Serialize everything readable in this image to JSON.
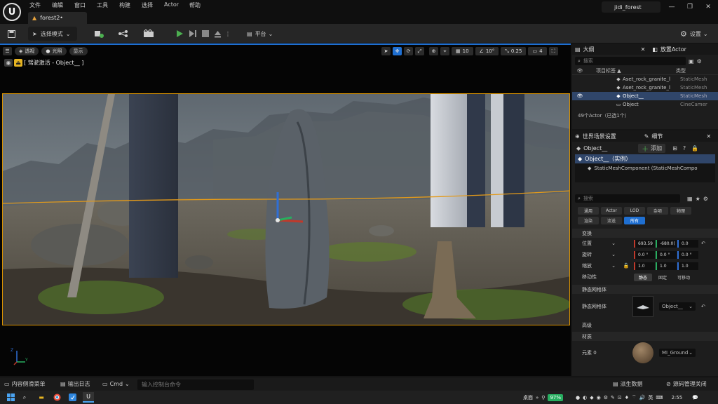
{
  "titlebar": {
    "logo": "U",
    "menu": [
      "文件",
      "编辑",
      "窗口",
      "工具",
      "构建",
      "选择",
      "Actor",
      "帮助"
    ],
    "doc_tab": "forest2•",
    "project": "jidi_forest"
  },
  "toolbar": {
    "select_mode": "选择模式",
    "platform": "平台",
    "settings": "设置"
  },
  "viewport": {
    "perspective": "透视",
    "lit": "光照",
    "show": "显示",
    "pilot_label": "[ 驾驶激活 - Object__ ]",
    "grid_value": "10",
    "angle_value": "10°",
    "scale_value": "0.25",
    "camera_speed": "4",
    "axis_z": "Z",
    "axis_y": "Y"
  },
  "outliner": {
    "tab": "大纲",
    "tab2": "放置Actor",
    "search_placeholder": "搜索",
    "col_label": "项目标签 ▲",
    "col_type": "类型",
    "rows": [
      {
        "label": "Aset_rock_granite_l",
        "type": "StaticMesh",
        "selected": false
      },
      {
        "label": "Aset_rock_granite_l",
        "type": "StaticMesh",
        "selected": false
      },
      {
        "label": "Object__",
        "type": "StaticMesh",
        "selected": true
      },
      {
        "label": "Object",
        "type": "CineCamer",
        "selected": false
      }
    ],
    "count": "49个Actor（已选1个）"
  },
  "details": {
    "tab1": "世界场景设置",
    "tab2": "细节",
    "object_name": "Object__",
    "add_button": "添加",
    "instance": "Object__（实例）",
    "component": "StaticMeshComponent (StaticMeshCompo",
    "search_placeholder": "搜索",
    "categories_row1": [
      "通用",
      "Actor",
      "LOD",
      "杂项",
      "物理"
    ],
    "categories_row2": [
      "渲染",
      "流送",
      "所有"
    ],
    "transform_header": "变换",
    "location_label": "位置",
    "rotation_label": "旋转",
    "scale_label": "缩放",
    "location": [
      "693.59",
      "-680.0(",
      "0.0"
    ],
    "rotation": [
      "0.0 °",
      "0.0 °",
      "0.0 °"
    ],
    "scale": [
      "1.0",
      "1.0",
      "1.0"
    ],
    "mobility_label": "移动性",
    "mobility": [
      "静态",
      "固定",
      "可移动"
    ],
    "static_mesh_header": "静态网格体",
    "static_mesh_label": "静态网格体",
    "static_mesh_value": "Object__",
    "advanced_header": "高级",
    "materials_header": "材质",
    "element_label": "元素 0",
    "material_value": "MI_Ground"
  },
  "bottombar": {
    "content_drawer": "内容侧滑菜单",
    "output_log": "输出日志",
    "cmd": "Cmd",
    "cmd_placeholder": "输入控制台命令",
    "derived_data": "派生数据",
    "source_control": "源码管理关闭"
  },
  "taskbar": {
    "desktop": "桌面",
    "battery": "97%",
    "ime": "英",
    "time": "2:55"
  },
  "colors": {
    "accent_blue": "#1f6fd1",
    "selection_orange": "#d99200",
    "play_green": "#4caf50",
    "x_red": "#c0392b",
    "y_green": "#27ae60",
    "z_blue": "#2f6fd6"
  }
}
